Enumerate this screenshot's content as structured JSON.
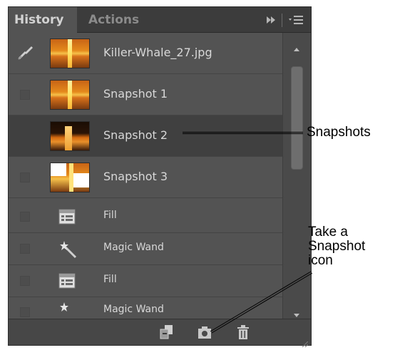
{
  "tabs": {
    "history": "History",
    "actions": "Actions"
  },
  "tab_controls": {
    "expand_icon": "double-arrow-icon",
    "menu_icon": "panel-menu-icon"
  },
  "history_items": [
    {
      "label": "Killer-Whale_27.jpg",
      "kind": "source",
      "icon": "history-brush-icon"
    },
    {
      "label": "Snapshot 1",
      "kind": "snapshot"
    },
    {
      "label": "Snapshot 2",
      "kind": "snapshot",
      "current": true
    },
    {
      "label": "Snapshot 3",
      "kind": "snapshot"
    },
    {
      "label": "Fill",
      "kind": "step",
      "icon": "fill-layer-icon"
    },
    {
      "label": "Magic Wand",
      "kind": "step",
      "icon": "magic-wand-icon"
    },
    {
      "label": "Fill",
      "kind": "step",
      "icon": "fill-layer-icon"
    },
    {
      "label": "Magic Wand",
      "kind": "step",
      "icon": "magic-wand-icon"
    }
  ],
  "bottom_toolbar": {
    "new_document_icon": "new-document-from-state-icon",
    "snapshot_icon": "camera-icon",
    "delete_icon": "trash-icon"
  },
  "annotations": {
    "snapshots": "Snapshots",
    "take_snapshot_line1": "Take a",
    "take_snapshot_line2": "Snapshot",
    "take_snapshot_line3": "icon"
  },
  "colors": {
    "panel_bg": "#535353",
    "tab_bar_bg": "#3c3c3c",
    "text": "#d8d8d8"
  }
}
